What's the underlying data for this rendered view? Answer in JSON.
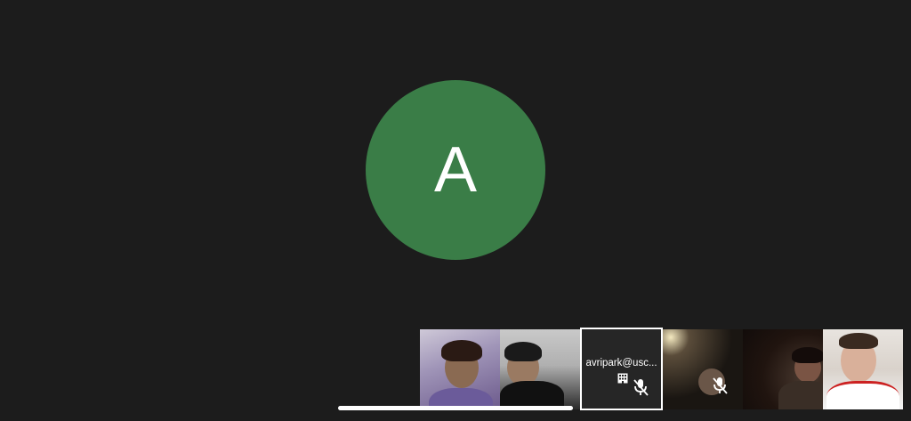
{
  "main": {
    "avatar_letter": "A",
    "avatar_color": "#3a7d47",
    "background_color": "#1c1c1c"
  },
  "participants": [
    {
      "id": "p1",
      "label": "",
      "muted": false
    },
    {
      "id": "p2",
      "label": "",
      "muted": false
    },
    {
      "id": "p3",
      "label": "avripark@usc...",
      "muted": true,
      "selected": true,
      "icon": "building-icon"
    },
    {
      "id": "p4",
      "label": "",
      "muted": true
    },
    {
      "id": "p5",
      "label": "",
      "muted": false
    },
    {
      "id": "p6",
      "label": "",
      "muted": false
    }
  ]
}
